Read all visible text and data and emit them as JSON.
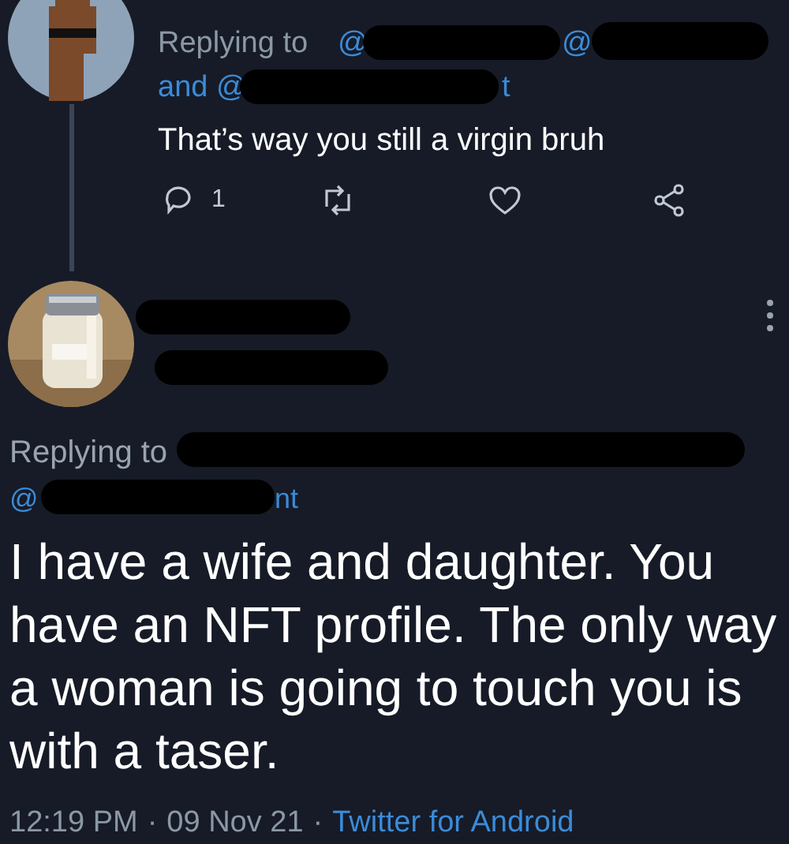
{
  "parent_tweet": {
    "replying_prefix": "Replying to",
    "mention_1": "@",
    "mention_2": "@",
    "and_prefix": "and @",
    "mention_3_tail": "t",
    "text": "That’s way you still a virgin bruh",
    "actions": [
      {
        "kind": "reply",
        "count": "1"
      },
      {
        "kind": "retweet"
      },
      {
        "kind": "like"
      },
      {
        "kind": "share"
      }
    ]
  },
  "main_tweet": {
    "replying_prefix": "Replying to",
    "mention_prefix": "@",
    "mention_tail": "nt",
    "text": "I have a wife and daughter. You have an NFT profile. The only way a woman is going to touch you is with a taser.",
    "time": "12:19 PM",
    "separator_1": "·",
    "date": "09 Nov 21",
    "separator_2": "·",
    "source": "Twitter for Android"
  }
}
